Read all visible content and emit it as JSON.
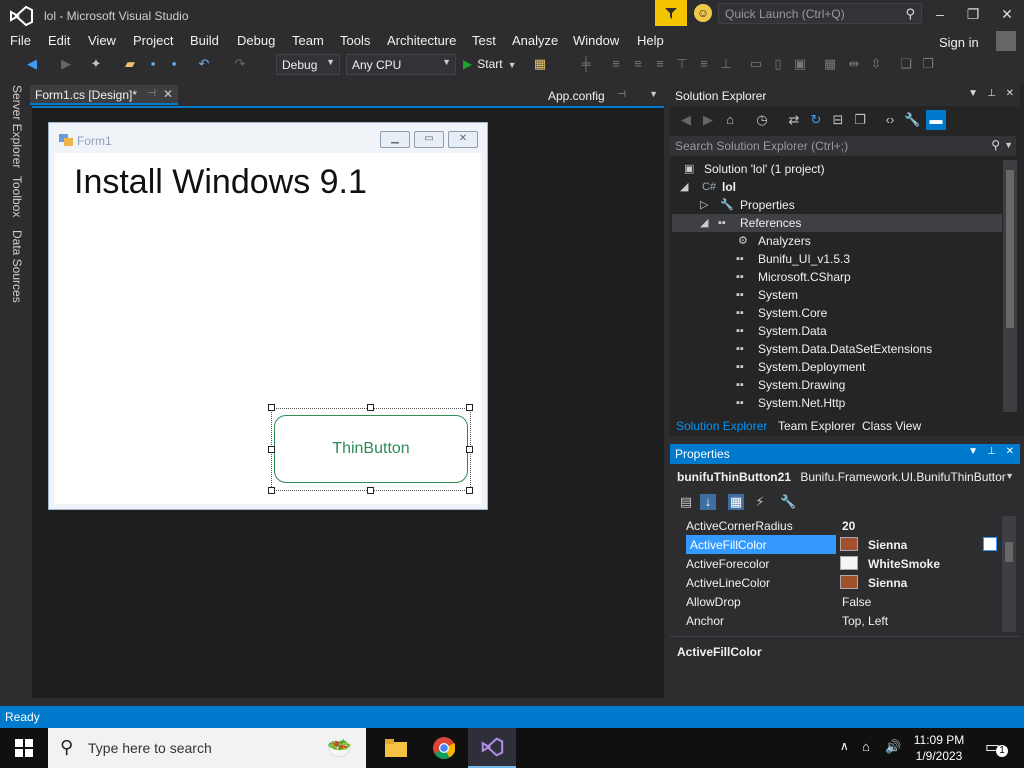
{
  "app": {
    "title": "lol - Microsoft Visual Studio",
    "quick_launch_placeholder": "Quick Launch (Ctrl+Q)",
    "sign_in": "Sign in"
  },
  "menu": [
    "File",
    "Edit",
    "View",
    "Project",
    "Build",
    "Debug",
    "Team",
    "Tools",
    "Architecture",
    "Test",
    "Analyze",
    "Window",
    "Help"
  ],
  "toolbar": {
    "config": "Debug",
    "platform": "Any CPU",
    "start": "Start"
  },
  "left_tabs": [
    "Server Explorer",
    "Toolbox",
    "Data Sources"
  ],
  "doc_tabs": {
    "active": "Form1.cs [Design]*",
    "other": "App.config"
  },
  "designer": {
    "form_title": "Form1",
    "heading": "Install Windows 9.1",
    "button_text": "ThinButton"
  },
  "solution_explorer": {
    "title": "Solution Explorer",
    "search_placeholder": "Search Solution Explorer (Ctrl+;)",
    "tree": [
      {
        "label": "Solution 'lol' (1 project)",
        "icon": "solution-icon",
        "depth": 0
      },
      {
        "label": "lol",
        "icon": "csharp-project-icon",
        "depth": 1,
        "bold": true
      },
      {
        "label": "Properties",
        "icon": "wrench-icon",
        "depth": 2
      },
      {
        "label": "References",
        "icon": "references-icon",
        "depth": 2,
        "selected": true
      },
      {
        "label": "Analyzers",
        "icon": "analyzer-icon",
        "depth": 3
      },
      {
        "label": "Bunifu_UI_v1.5.3",
        "icon": "reference-icon",
        "depth": 3
      },
      {
        "label": "Microsoft.CSharp",
        "icon": "reference-icon",
        "depth": 3
      },
      {
        "label": "System",
        "icon": "reference-icon",
        "depth": 3
      },
      {
        "label": "System.Core",
        "icon": "reference-icon",
        "depth": 3
      },
      {
        "label": "System.Data",
        "icon": "reference-icon",
        "depth": 3
      },
      {
        "label": "System.Data.DataSetExtensions",
        "icon": "reference-icon",
        "depth": 3
      },
      {
        "label": "System.Deployment",
        "icon": "reference-icon",
        "depth": 3
      },
      {
        "label": "System.Drawing",
        "icon": "reference-icon",
        "depth": 3
      },
      {
        "label": "System.Net.Http",
        "icon": "reference-icon",
        "depth": 3
      }
    ],
    "tabs": [
      "Solution Explorer",
      "Team Explorer",
      "Class View"
    ]
  },
  "properties": {
    "title": "Properties",
    "object": "bunifuThinButton21",
    "object_type": "Bunifu.Framework.UI.BunifuThinButtor",
    "rows": [
      {
        "name": "ActiveCornerRadius",
        "value": "20",
        "bold": true
      },
      {
        "name": "ActiveFillColor",
        "value": "Sienna",
        "swatch": "#a0522d",
        "bold": true,
        "selected": true
      },
      {
        "name": "ActiveForecolor",
        "value": "WhiteSmoke",
        "swatch": "#f5f5f5",
        "bold": true
      },
      {
        "name": "ActiveLineColor",
        "value": "Sienna",
        "swatch": "#a0522d",
        "bold": true
      },
      {
        "name": "AllowDrop",
        "value": "False"
      },
      {
        "name": "Anchor",
        "value": "Top, Left"
      }
    ],
    "description": "ActiveFillColor"
  },
  "status": "Ready",
  "taskbar": {
    "search_placeholder": "Type here to search",
    "time": "11:09 PM",
    "date": "1/9/2023",
    "notifications": "1"
  },
  "colors": {
    "accent": "#007acc",
    "button_line": "#2e8b57",
    "sienna": "#a0522d"
  }
}
